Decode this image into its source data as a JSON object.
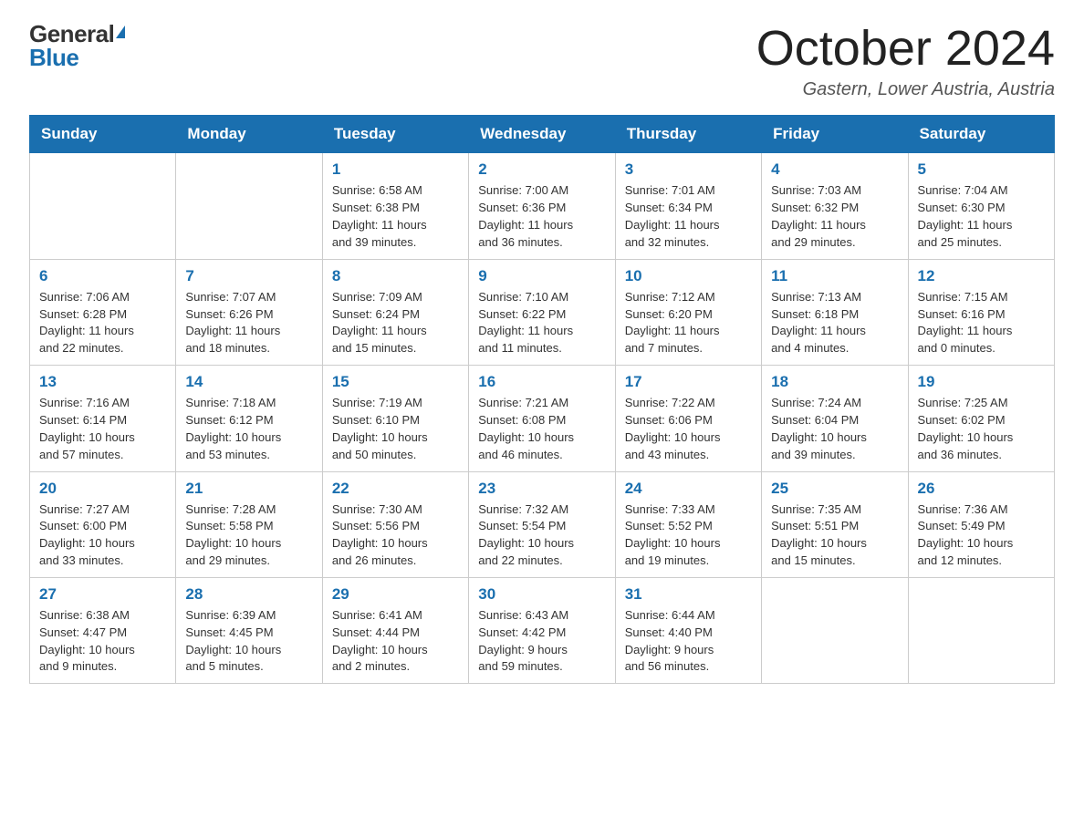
{
  "logo": {
    "general": "General",
    "blue": "Blue"
  },
  "title": "October 2024",
  "location": "Gastern, Lower Austria, Austria",
  "days_of_week": [
    "Sunday",
    "Monday",
    "Tuesday",
    "Wednesday",
    "Thursday",
    "Friday",
    "Saturday"
  ],
  "weeks": [
    [
      {
        "day": "",
        "info": ""
      },
      {
        "day": "",
        "info": ""
      },
      {
        "day": "1",
        "info": "Sunrise: 6:58 AM\nSunset: 6:38 PM\nDaylight: 11 hours\nand 39 minutes."
      },
      {
        "day": "2",
        "info": "Sunrise: 7:00 AM\nSunset: 6:36 PM\nDaylight: 11 hours\nand 36 minutes."
      },
      {
        "day": "3",
        "info": "Sunrise: 7:01 AM\nSunset: 6:34 PM\nDaylight: 11 hours\nand 32 minutes."
      },
      {
        "day": "4",
        "info": "Sunrise: 7:03 AM\nSunset: 6:32 PM\nDaylight: 11 hours\nand 29 minutes."
      },
      {
        "day": "5",
        "info": "Sunrise: 7:04 AM\nSunset: 6:30 PM\nDaylight: 11 hours\nand 25 minutes."
      }
    ],
    [
      {
        "day": "6",
        "info": "Sunrise: 7:06 AM\nSunset: 6:28 PM\nDaylight: 11 hours\nand 22 minutes."
      },
      {
        "day": "7",
        "info": "Sunrise: 7:07 AM\nSunset: 6:26 PM\nDaylight: 11 hours\nand 18 minutes."
      },
      {
        "day": "8",
        "info": "Sunrise: 7:09 AM\nSunset: 6:24 PM\nDaylight: 11 hours\nand 15 minutes."
      },
      {
        "day": "9",
        "info": "Sunrise: 7:10 AM\nSunset: 6:22 PM\nDaylight: 11 hours\nand 11 minutes."
      },
      {
        "day": "10",
        "info": "Sunrise: 7:12 AM\nSunset: 6:20 PM\nDaylight: 11 hours\nand 7 minutes."
      },
      {
        "day": "11",
        "info": "Sunrise: 7:13 AM\nSunset: 6:18 PM\nDaylight: 11 hours\nand 4 minutes."
      },
      {
        "day": "12",
        "info": "Sunrise: 7:15 AM\nSunset: 6:16 PM\nDaylight: 11 hours\nand 0 minutes."
      }
    ],
    [
      {
        "day": "13",
        "info": "Sunrise: 7:16 AM\nSunset: 6:14 PM\nDaylight: 10 hours\nand 57 minutes."
      },
      {
        "day": "14",
        "info": "Sunrise: 7:18 AM\nSunset: 6:12 PM\nDaylight: 10 hours\nand 53 minutes."
      },
      {
        "day": "15",
        "info": "Sunrise: 7:19 AM\nSunset: 6:10 PM\nDaylight: 10 hours\nand 50 minutes."
      },
      {
        "day": "16",
        "info": "Sunrise: 7:21 AM\nSunset: 6:08 PM\nDaylight: 10 hours\nand 46 minutes."
      },
      {
        "day": "17",
        "info": "Sunrise: 7:22 AM\nSunset: 6:06 PM\nDaylight: 10 hours\nand 43 minutes."
      },
      {
        "day": "18",
        "info": "Sunrise: 7:24 AM\nSunset: 6:04 PM\nDaylight: 10 hours\nand 39 minutes."
      },
      {
        "day": "19",
        "info": "Sunrise: 7:25 AM\nSunset: 6:02 PM\nDaylight: 10 hours\nand 36 minutes."
      }
    ],
    [
      {
        "day": "20",
        "info": "Sunrise: 7:27 AM\nSunset: 6:00 PM\nDaylight: 10 hours\nand 33 minutes."
      },
      {
        "day": "21",
        "info": "Sunrise: 7:28 AM\nSunset: 5:58 PM\nDaylight: 10 hours\nand 29 minutes."
      },
      {
        "day": "22",
        "info": "Sunrise: 7:30 AM\nSunset: 5:56 PM\nDaylight: 10 hours\nand 26 minutes."
      },
      {
        "day": "23",
        "info": "Sunrise: 7:32 AM\nSunset: 5:54 PM\nDaylight: 10 hours\nand 22 minutes."
      },
      {
        "day": "24",
        "info": "Sunrise: 7:33 AM\nSunset: 5:52 PM\nDaylight: 10 hours\nand 19 minutes."
      },
      {
        "day": "25",
        "info": "Sunrise: 7:35 AM\nSunset: 5:51 PM\nDaylight: 10 hours\nand 15 minutes."
      },
      {
        "day": "26",
        "info": "Sunrise: 7:36 AM\nSunset: 5:49 PM\nDaylight: 10 hours\nand 12 minutes."
      }
    ],
    [
      {
        "day": "27",
        "info": "Sunrise: 6:38 AM\nSunset: 4:47 PM\nDaylight: 10 hours\nand 9 minutes."
      },
      {
        "day": "28",
        "info": "Sunrise: 6:39 AM\nSunset: 4:45 PM\nDaylight: 10 hours\nand 5 minutes."
      },
      {
        "day": "29",
        "info": "Sunrise: 6:41 AM\nSunset: 4:44 PM\nDaylight: 10 hours\nand 2 minutes."
      },
      {
        "day": "30",
        "info": "Sunrise: 6:43 AM\nSunset: 4:42 PM\nDaylight: 9 hours\nand 59 minutes."
      },
      {
        "day": "31",
        "info": "Sunrise: 6:44 AM\nSunset: 4:40 PM\nDaylight: 9 hours\nand 56 minutes."
      },
      {
        "day": "",
        "info": ""
      },
      {
        "day": "",
        "info": ""
      }
    ]
  ]
}
